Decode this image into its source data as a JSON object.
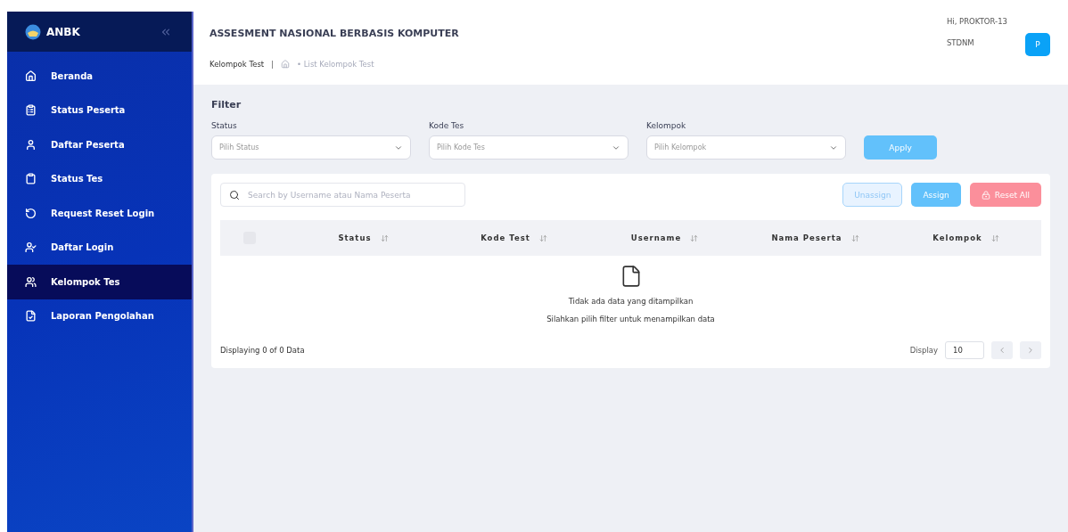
{
  "sidebar": {
    "logo": "ANBK",
    "items": [
      {
        "label": "Beranda",
        "selected": false
      },
      {
        "label": "Status Peserta",
        "selected": false
      },
      {
        "label": "Daftar Peserta",
        "selected": false
      },
      {
        "label": "Status Tes",
        "selected": false
      },
      {
        "label": "Request Reset Login",
        "selected": false
      },
      {
        "label": "Daftar Login",
        "selected": false
      },
      {
        "label": "Kelompok Tes",
        "selected": true
      },
      {
        "label": "Laporan Pengolahan",
        "selected": false
      }
    ]
  },
  "header": {
    "title": "ASSESMENT NASIONAL BERBASIS KOMPUTER",
    "greeting": "Hi, PROKTOR-13",
    "school": "STDNM",
    "avatar": "P",
    "breadcrumb": {
      "page": "Kelompok Test",
      "separator": "|",
      "trail": "• List Kelompok Test"
    }
  },
  "filter": {
    "title": "Filter",
    "fields": [
      {
        "label": "Status",
        "placeholder": "Pilih Status"
      },
      {
        "label": "Kode Tes",
        "placeholder": "Pilih Kode Tes"
      },
      {
        "label": "Kelompok",
        "placeholder": "Pilih Kelompok"
      }
    ],
    "apply": "Apply"
  },
  "table": {
    "search": {
      "placeholder": "Search by Username atau Nama Peserta"
    },
    "buttons": [
      {
        "label": "Unassign",
        "kind": "outline"
      },
      {
        "label": "Assign",
        "kind": "primary"
      },
      {
        "label": "Reset All",
        "kind": "danger"
      }
    ],
    "select_all": {
      "checked": false
    },
    "columns": [
      "Status",
      "Kode Test",
      "Username",
      "Nama Peserta",
      "Kelompok"
    ],
    "empty": {
      "title": "Tidak ada data yang ditampilkan",
      "hint": "Silahkan pilih filter untuk menampilkan data"
    },
    "footer": {
      "summary": "Displaying 0 of 0 Data",
      "display_label": "Display",
      "page_size": "10"
    }
  }
}
